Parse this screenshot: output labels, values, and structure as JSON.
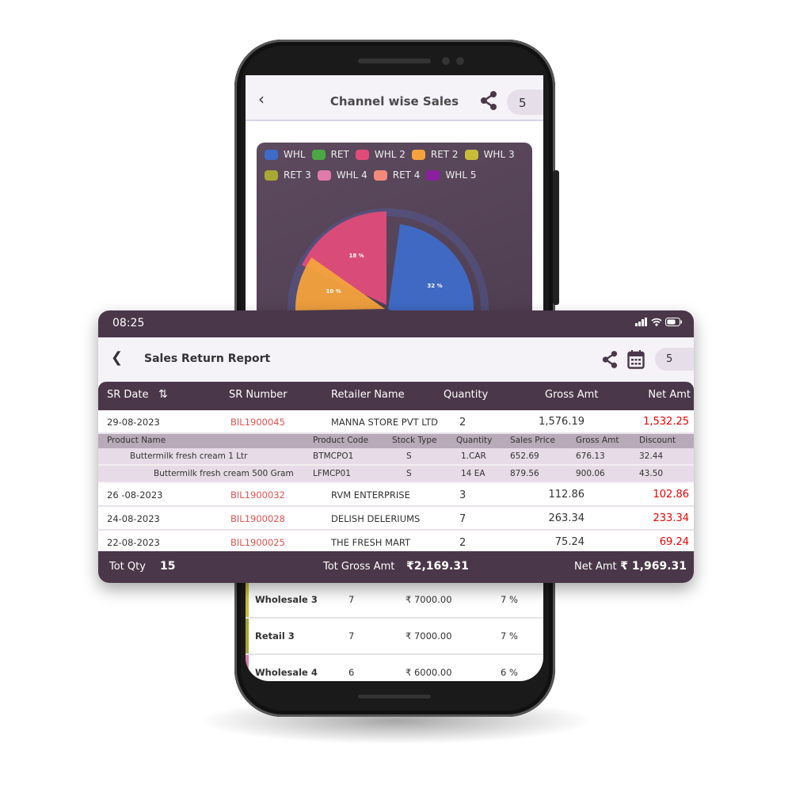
{
  "phone": {
    "title": "Channel wise Sales",
    "pill": "5",
    "legend": [
      {
        "label": "WHL",
        "color": "#3e6bc9"
      },
      {
        "label": "RET",
        "color": "#4aa845"
      },
      {
        "label": "WHL 2",
        "color": "#e04c7a"
      },
      {
        "label": "RET 2",
        "color": "#f4a23c"
      },
      {
        "label": "WHL 3",
        "color": "#c8bd3a"
      },
      {
        "label": "RET 3",
        "color": "#a8a834"
      },
      {
        "label": "WHL 4",
        "color": "#e07aaa"
      },
      {
        "label": "RET 4",
        "color": "#f48a7a"
      },
      {
        "label": "WHL 5",
        "color": "#8b1fa0"
      }
    ],
    "rows": [
      {
        "name": "Wholesale 3",
        "qty": "7",
        "amt": "₹ 7000.00",
        "pct": "7 %",
        "color": "#c8bd3a"
      },
      {
        "name": "Retail 3",
        "qty": "7",
        "amt": "₹ 7000.00",
        "pct": "7  %",
        "color": "#a8a834"
      },
      {
        "name": "Wholesale 4",
        "qty": "6",
        "amt": "₹ 6000.00",
        "pct": "6 %",
        "color": "#e07aaa"
      }
    ]
  },
  "chart_data": {
    "type": "pie",
    "slices": [
      {
        "name": "WHL",
        "value": 32,
        "label": "32 %",
        "color": "#3e6bc9"
      },
      {
        "name": "WHL 2",
        "value": 18,
        "label": "18 %",
        "color": "#e04c7a"
      },
      {
        "name": "RET 2",
        "value": 10,
        "label": "10 %",
        "color": "#f4a23c"
      }
    ]
  },
  "status": {
    "time": "08:25"
  },
  "report": {
    "title": "Sales Return Report",
    "pill": "5",
    "headers": [
      "SR Date",
      "SR Number",
      "Retailer Name",
      "Quantity",
      "Gross Amt",
      "Net Amt"
    ],
    "sub_headers": [
      "Product Name",
      "Product Code",
      "Stock Type",
      "Quantity",
      "Sales Price",
      "Gross Amt",
      "Discount"
    ],
    "rows": [
      {
        "date": "29-08-2023",
        "sr": "BIL1900045",
        "retailer": "MANNA STORE PVT LTD",
        "qty": "2",
        "gross": "1,576.19",
        "net": "1,532.25",
        "items": [
          {
            "name": "Buttermilk fresh cream 1 Ltr",
            "code": "BTMCPO1",
            "stock": "S",
            "qty": "1.CAR",
            "price": "652.69",
            "gross": "676.13",
            "disc": "32.44"
          },
          {
            "name": "Buttermilk fresh cream 500 Gram",
            "code": "LFMCP01",
            "stock": "S",
            "qty": "14  EA",
            "price": "879.56",
            "gross": "900.06",
            "disc": "43.50"
          }
        ]
      },
      {
        "date": "26 -08-2023",
        "sr": "BIL1900032",
        "retailer": "RVM ENTERPRISE",
        "qty": "3",
        "gross": "112.86",
        "net": "102.86"
      },
      {
        "date": "24-08-2023",
        "sr": "BIL1900028",
        "retailer": "DELISH DELERIUMS",
        "qty": "7",
        "gross": "263.34",
        "net": "233.34"
      },
      {
        "date": "22-08-2023",
        "sr": "BIL1900025",
        "retailer": "THE FRESH MART",
        "qty": "2",
        "gross": "75.24",
        "net": "69.24"
      }
    ],
    "footer": {
      "tot_qty_label": "Tot Qty",
      "tot_qty": "15",
      "tot_gross_label": "Tot Gross Amt",
      "tot_gross": "₹2,169.31",
      "net_label": "Net Amt",
      "net": "₹ 1,969.31"
    }
  }
}
